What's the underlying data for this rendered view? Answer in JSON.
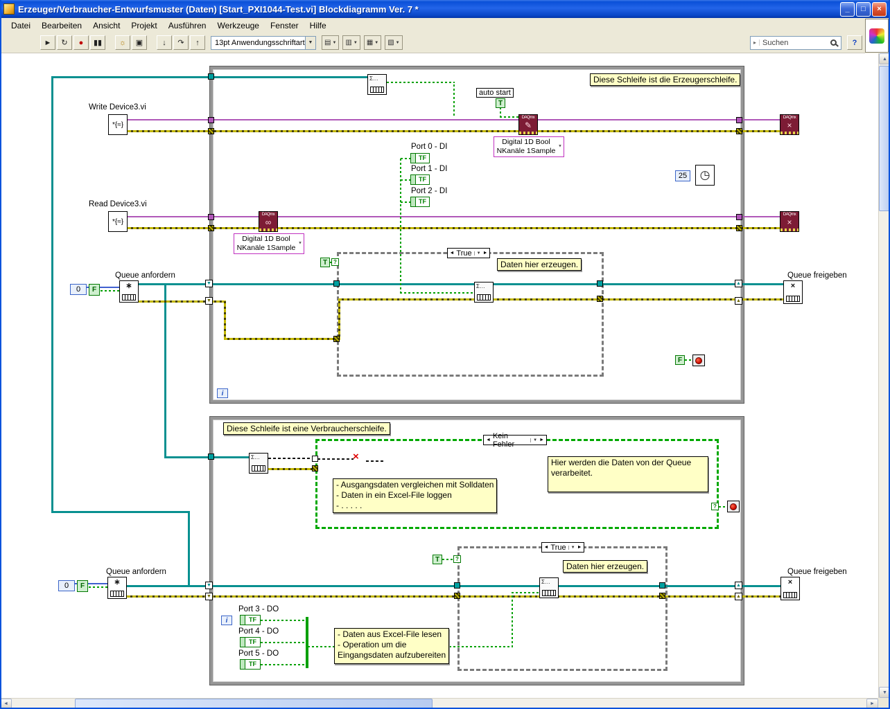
{
  "window": {
    "title": "Erzeuger/Verbraucher-Entwurfsmuster (Daten) [Start_PXI1044-Test.vi] Blockdiagramm Ver. 7 *",
    "minimize_glyph": "_",
    "maximize_glyph": "□",
    "close_glyph": "×"
  },
  "menu": {
    "items": [
      "Datei",
      "Bearbeiten",
      "Ansicht",
      "Projekt",
      "Ausführen",
      "Werkzeuge",
      "Fenster",
      "Hilfe"
    ]
  },
  "toolbar": {
    "run_glyph": "►",
    "run_cont_glyph": "↻",
    "abort_glyph": "●",
    "pause_glyph": "▮▮",
    "highlight_glyph": "☼",
    "retain_glyph": "▣",
    "step_into_glyph": "↓",
    "step_over_glyph": "↷",
    "step_out_glyph": "↑",
    "font_selector": "13pt Anwendungsschriftart",
    "align_glyph": "▤",
    "distribute_glyph": "▥",
    "resize_glyph": "▦",
    "reorder_glyph": "▧",
    "dropdown_glyph": "▼",
    "search_prefix": "▸",
    "search_value": "Suchen",
    "help_label": "?"
  },
  "scrollbar": {
    "up": "▲",
    "down": "▼",
    "left": "◄",
    "right": "►"
  },
  "glyphs": {
    "case_left": "◄",
    "case_right": "►",
    "dropdown": "▼",
    "sr_up": "▲",
    "sr_down": "▼",
    "qmark": "?"
  },
  "icons": {
    "daqmx": "DAQmx",
    "write_glyph": "✎",
    "read_glyph": "∞",
    "clear_glyph": "×",
    "vi_glyph": "*{≈}",
    "sigma": "Σ…",
    "obtain_glyph": "∗",
    "release_glyph": "×",
    "clock_glyph": "◷",
    "broken_glyph": "×"
  },
  "producer": {
    "comment": "Diese Schleife ist die Erzeugerschleife.",
    "write_vi_label": "Write Device3.vi",
    "read_vi_label": "Read Device3.vi",
    "auto_start_label": "auto start",
    "poly_line1": "Digital 1D Bool",
    "poly_line2": "NKanäle 1Sample",
    "ports": [
      "Port 0 - DI",
      "Port 1 - DI",
      "Port 2 - DI"
    ],
    "case_selector": "True",
    "case_comment": "Daten hier erzeugen.",
    "queue_obtain_label": "Queue anfordern",
    "queue_release_label": "Queue freigeben",
    "wait_ms": "25",
    "queue_size": "0"
  },
  "consumer": {
    "comment": "Diese Schleife ist eine Verbraucherschleife.",
    "error_case_selector": "Kein Fehler",
    "process_comment": "Hier werden die Daten von der Queue verarbeitet.",
    "tasks_lines": [
      "- Ausgangsdaten vergleichen mit Solldaten",
      "- Daten in ein Excel-File loggen",
      "- . . . . ."
    ],
    "inner_case_selector": "True",
    "inner_case_comment": "Daten hier erzeugen.",
    "queue_obtain_label": "Queue anfordern",
    "queue_release_label": "Queue freigeben",
    "queue_size": "0",
    "ports": [
      "Port 3 - DO",
      "Port 4 - DO",
      "Port 5 - DO"
    ],
    "excel_lines": [
      "- Daten aus Excel-File lesen",
      "- Operation um die",
      "Eingangsdaten aufzubereiten"
    ]
  },
  "constants": {
    "t": "T",
    "f": "F",
    "tf": "TF",
    "iter": "i"
  }
}
